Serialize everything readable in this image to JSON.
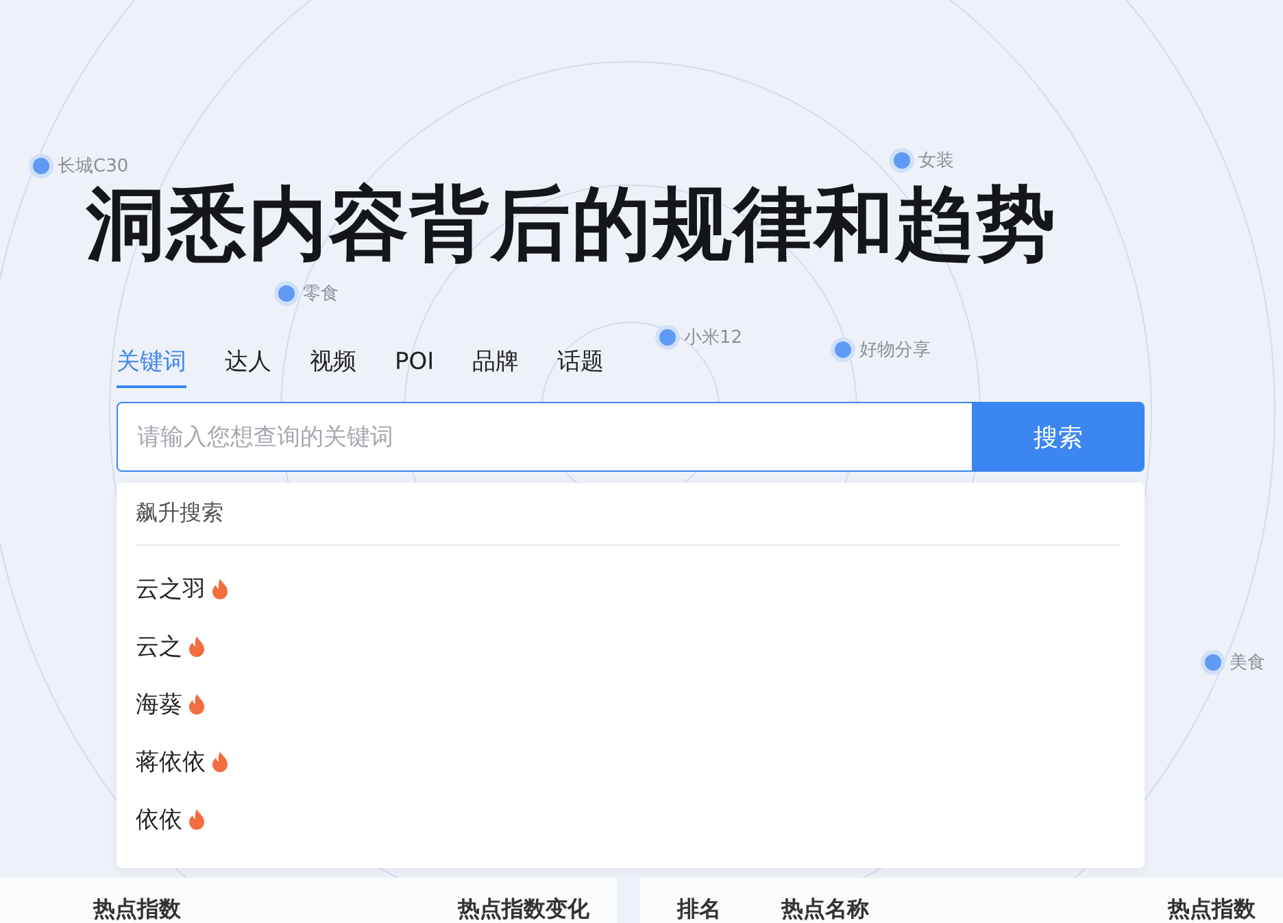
{
  "bubbles": [
    {
      "label": "长城C30"
    },
    {
      "label": "女装"
    },
    {
      "label": "零食"
    },
    {
      "label": "小米12"
    },
    {
      "label": "好物分享"
    },
    {
      "label": "美食"
    }
  ],
  "headline": "洞悉内容背后的规律和趋势",
  "tabs": [
    {
      "label": "关键词",
      "selected": true
    },
    {
      "label": "达人",
      "selected": false
    },
    {
      "label": "视频",
      "selected": false
    },
    {
      "label": "POI",
      "selected": false
    },
    {
      "label": "品牌",
      "selected": false
    },
    {
      "label": "话题",
      "selected": false
    }
  ],
  "search": {
    "placeholder": "请输入您想查询的关键词",
    "button": "搜索"
  },
  "dropdown": {
    "title": "飙升搜索",
    "items": [
      {
        "label": "云之羽",
        "hot": true
      },
      {
        "label": "云之",
        "hot": true
      },
      {
        "label": "海葵",
        "hot": true
      },
      {
        "label": "蒋依依",
        "hot": true
      },
      {
        "label": "依依",
        "hot": true
      }
    ]
  },
  "tables": [
    {
      "columns": [
        "热点指数",
        "热点指数变化"
      ]
    },
    {
      "columns": [
        "排名",
        "热点名称",
        "热点指数"
      ]
    }
  ]
}
